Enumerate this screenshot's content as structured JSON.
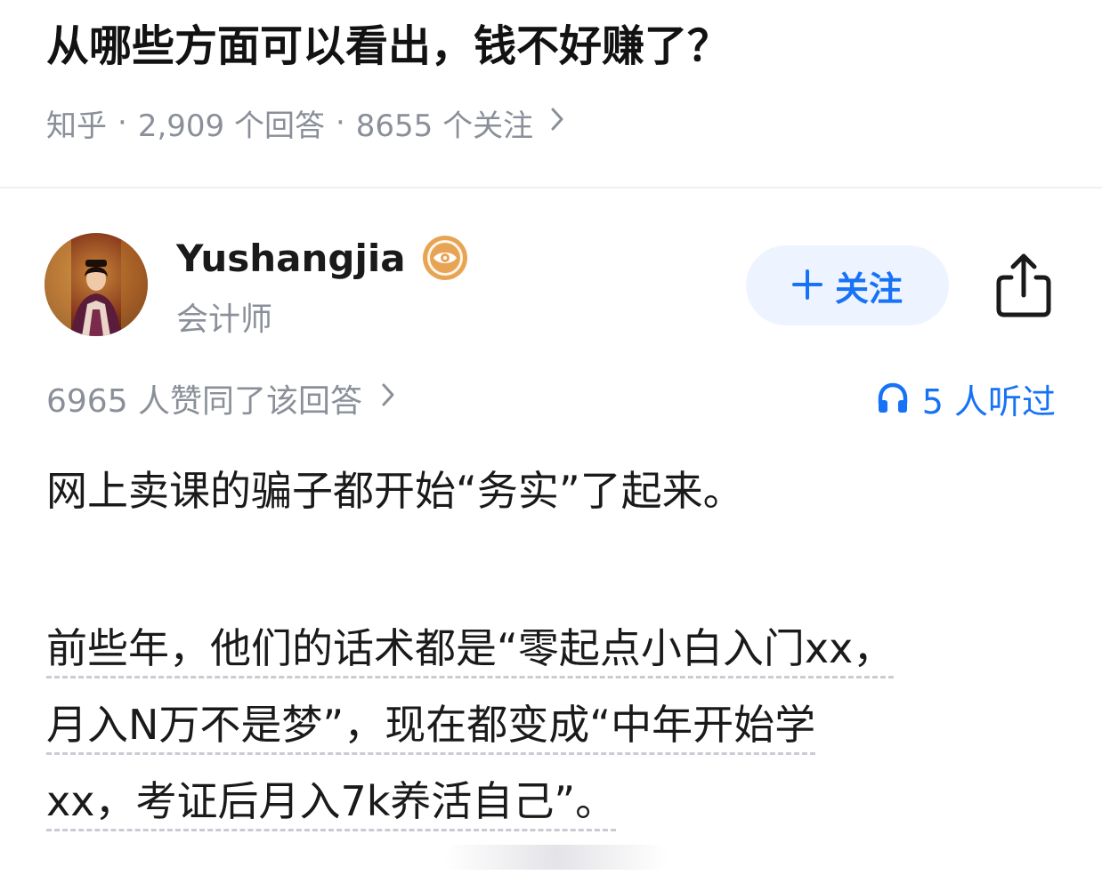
{
  "question": {
    "title": "从哪些方面可以看出，钱不好赚了？",
    "source": "知乎",
    "separator": "·",
    "answers_count": "2,909 个回答",
    "followers_count": "8655 个关注"
  },
  "author": {
    "name": "Yushangjia",
    "title": "会计师",
    "badge_icon": "verified-eye-badge",
    "badge_color": "#e8a455"
  },
  "actions": {
    "follow_label": "关注",
    "follow_icon": "plus-icon",
    "share_icon": "share-icon",
    "accent_color": "#1772f6",
    "follow_bg": "#eef4ff"
  },
  "stats": {
    "upvote_text": "6965 人赞同了该回答",
    "listen_icon": "headphones-icon",
    "listen_text": "5 人听过"
  },
  "answer": {
    "paragraph1": "网上卖课的骗子都开始“务实”了起来。",
    "paragraph2_lines": [
      "前些年，他们的话术都是“零起点小白入门xx，",
      "月入N万不是梦”，现在都变成“中年开始学",
      "xx，考证后月入7k养活自己”。"
    ]
  }
}
